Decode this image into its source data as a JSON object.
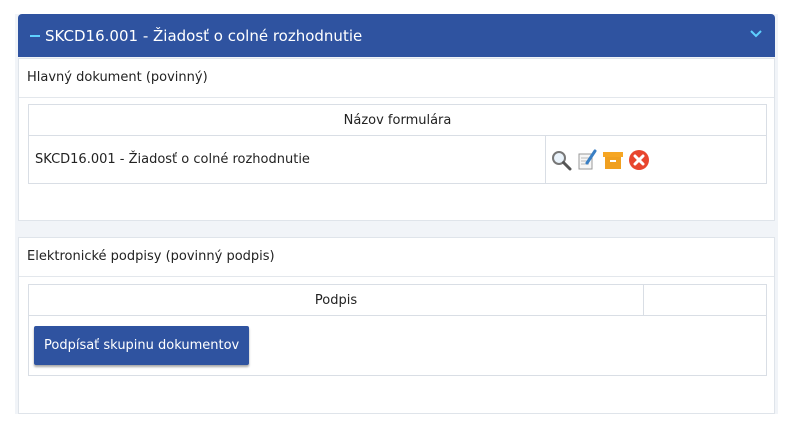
{
  "header": {
    "title": "SKCD16.001 - Žiadosť o colné rozhodnutie"
  },
  "main_document": {
    "section_title": "Hlavný dokument (povinný)",
    "table_header": "Názov formulára",
    "row_name": "SKCD16.001 - Žiadosť o colné rozhodnutie",
    "actions": [
      "search-icon",
      "edit-form-icon",
      "archive-icon",
      "delete-icon"
    ]
  },
  "signatures": {
    "section_title": "Elektronické podpisy (povinný podpis)",
    "table_header": "Podpis",
    "sign_button": "Podpísať skupinu dokumentov"
  },
  "colors": {
    "header_bg": "#2f53a0",
    "accent": "#5fd0ff",
    "delete": "#e8462e",
    "archive": "#f0a020"
  }
}
